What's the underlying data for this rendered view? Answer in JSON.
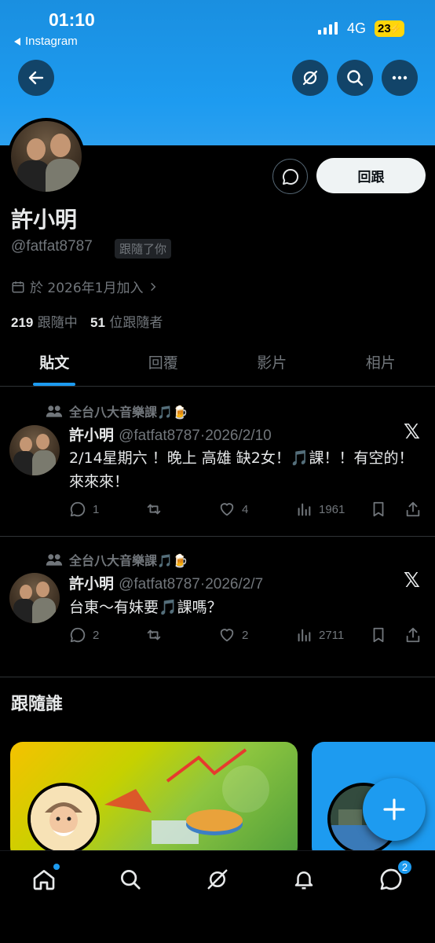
{
  "status_bar": {
    "time": "01:10",
    "back_app": "Instagram",
    "network": "4G",
    "battery": "23"
  },
  "profile": {
    "name": "許小明",
    "handle": "@fatfat8787",
    "follows_you_badge": "跟隨了你",
    "joined": "於 2026年1月加入",
    "following_count": "219",
    "following_label": "跟隨中",
    "followers_count": "51",
    "followers_label": "位跟隨者",
    "follow_back_label": "回跟"
  },
  "tabs": [
    {
      "label": "貼文",
      "active": true
    },
    {
      "label": "回覆",
      "active": false
    },
    {
      "label": "影片",
      "active": false
    },
    {
      "label": "相片",
      "active": false
    }
  ],
  "posts": [
    {
      "community": "全台八大音樂課🎵🍺",
      "name": "許小明",
      "meta": "@fatfat8787·2026/2/10",
      "text": "2/14星期六 ！晚上 高雄 缺2女！🎵課！！有空的！來來來！",
      "replies": "1",
      "reposts": "",
      "likes": "4",
      "views": "1961"
    },
    {
      "community": "全台八大音樂課🎵🍺",
      "name": "許小明",
      "meta": "@fatfat8787·2026/2/7",
      "text": "台東～有妹要🎵課嗎？",
      "replies": "2",
      "reposts": "",
      "likes": "2",
      "views": "2711"
    }
  ],
  "who_to_follow": {
    "title": "跟隨誰"
  },
  "nav": {
    "messages_badge": "2"
  },
  "colors": {
    "accent": "#1d9bf0",
    "background": "#000000",
    "muted": "#71767b"
  }
}
